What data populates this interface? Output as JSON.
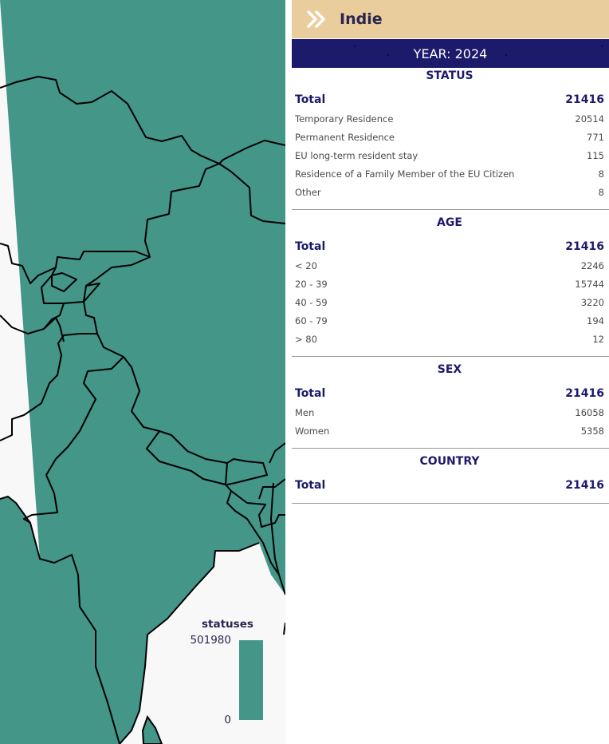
{
  "map": {
    "fill_color": "#439688",
    "border_color": "#000000",
    "background_color": "#f8f8f8",
    "legend": {
      "title": "statuses",
      "max": "501980",
      "min": "0"
    }
  },
  "panel": {
    "toggle_icon": "double-chevron-right-icon",
    "title": "Indie",
    "year_label": "YEAR:",
    "year": "2024",
    "colors": {
      "header": "#e9cd9c",
      "year_bar": "#1c1a6b",
      "text": "#1c1a6b"
    },
    "sections": [
      {
        "title": "STATUS",
        "total": {
          "label": "Total",
          "value": "21416"
        },
        "rows": [
          {
            "label": "Temporary Residence",
            "value": "20514"
          },
          {
            "label": "Permanent Residence",
            "value": "771"
          },
          {
            "label": "EU long-term resident stay",
            "value": "115"
          },
          {
            "label": "Residence of a Family Member of the EU Citizen",
            "value": "8"
          },
          {
            "label": "Other",
            "value": "8"
          }
        ]
      },
      {
        "title": "AGE",
        "total": {
          "label": "Total",
          "value": "21416"
        },
        "rows": [
          {
            "label": "< 20",
            "value": "2246"
          },
          {
            "label": "20 - 39",
            "value": "15744"
          },
          {
            "label": "40 - 59",
            "value": "3220"
          },
          {
            "label": "60 - 79",
            "value": "194"
          },
          {
            "label": "> 80",
            "value": "12"
          }
        ]
      },
      {
        "title": "SEX",
        "total": {
          "label": "Total",
          "value": "21416"
        },
        "rows": [
          {
            "label": "Men",
            "value": "16058"
          },
          {
            "label": "Women",
            "value": "5358"
          }
        ]
      },
      {
        "title": "COUNTRY",
        "total": {
          "label": "Total",
          "value": "21416"
        },
        "rows": []
      }
    ]
  }
}
